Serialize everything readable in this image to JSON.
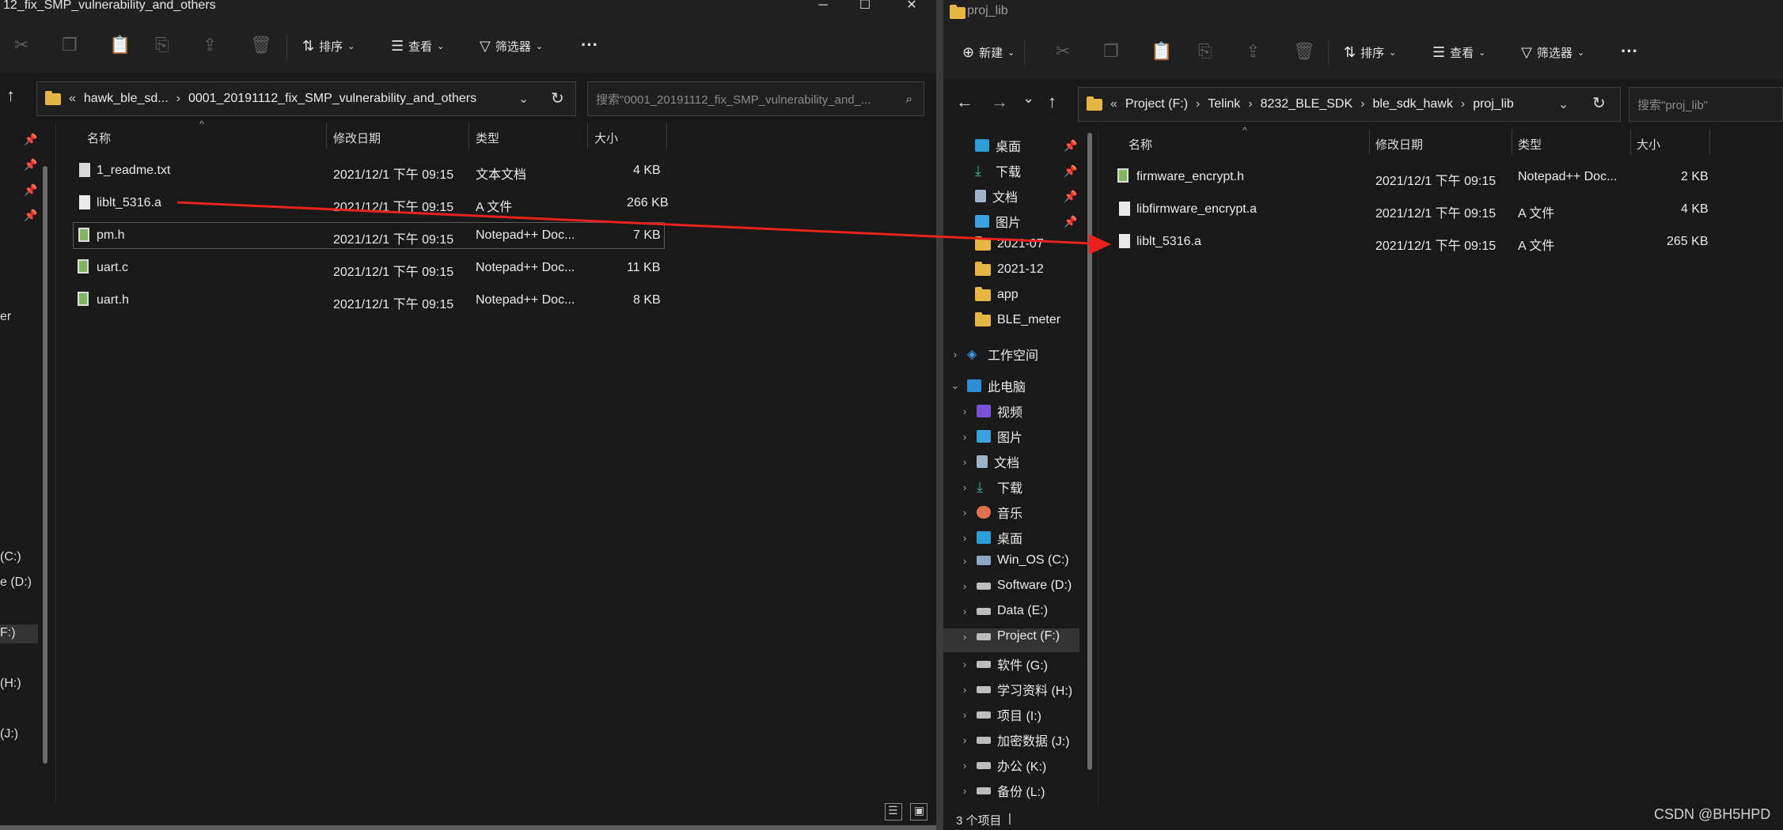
{
  "left_window": {
    "title": "12_fix_SMP_vulnerability_and_others",
    "toolbar": {
      "sort_label": "排序",
      "view_label": "查看",
      "filter_label": "筛选器",
      "more_label": "···"
    },
    "address": {
      "overflow": "«",
      "crumbs": [
        "hawk_ble_sd...",
        "0001_20191112_fix_SMP_vulnerability_and_others"
      ],
      "search_placeholder": "搜索\"0001_20191112_fix_SMP_vulnerability_and_..."
    },
    "columns": {
      "name": "名称",
      "date": "修改日期",
      "type": "类型",
      "size": "大小"
    },
    "files": [
      {
        "name": "1_readme.txt",
        "date": "2021/12/1 下午 09:15",
        "type": "文本文档",
        "size": "4 KB",
        "icon": "text-file-icon"
      },
      {
        "name": "liblt_5316.a",
        "date": "2021/12/1 下午 09:15",
        "type": "A 文件",
        "size": "266 KB",
        "icon": "file-icon"
      },
      {
        "name": "pm.h",
        "date": "2021/12/1 下午 09:15",
        "type": "Notepad++ Doc...",
        "size": "7 KB",
        "icon": "notepadpp-file-icon"
      },
      {
        "name": "uart.c",
        "date": "2021/12/1 下午 09:15",
        "type": "Notepad++ Doc...",
        "size": "11 KB",
        "icon": "notepadpp-file-icon"
      },
      {
        "name": "uart.h",
        "date": "2021/12/1 下午 09:15",
        "type": "Notepad++ Doc...",
        "size": "8 KB",
        "icon": "notepadpp-file-icon"
      }
    ],
    "left_edge_labels": [
      "er",
      "(C:)",
      "e (D:)",
      "F:)",
      "(H:)",
      "(J:)"
    ]
  },
  "right_window": {
    "title": "proj_lib",
    "toolbar": {
      "new_label": "新建",
      "sort_label": "排序",
      "view_label": "查看",
      "filter_label": "筛选器",
      "more_label": "···"
    },
    "address": {
      "overflow": "«",
      "crumbs": [
        "Project (F:)",
        "Telink",
        "8232_BLE_SDK",
        "ble_sdk_hawk",
        "proj_lib"
      ],
      "search_placeholder": "搜索\"proj_lib\""
    },
    "nav": {
      "quick_access": [
        "桌面",
        "下载",
        "文档",
        "图片",
        "2021-07",
        "2021-12",
        "app",
        "BLE_meter"
      ],
      "workspace": "工作空间",
      "this_pc": "此电脑",
      "pc_items": [
        "视频",
        "图片",
        "文档",
        "下载",
        "音乐",
        "桌面",
        "Win_OS (C:)",
        "Software (D:)",
        "Data (E:)",
        "Project (F:)",
        "软件 (G:)",
        "学习资料 (H:)",
        "项目 (I:)",
        "加密数据 (J:)",
        "办公 (K:)",
        "备份 (L:)"
      ]
    },
    "columns": {
      "name": "名称",
      "date": "修改日期",
      "type": "类型",
      "size": "大小"
    },
    "files": [
      {
        "name": "firmware_encrypt.h",
        "date": "2021/12/1 下午 09:15",
        "type": "Notepad++ Doc...",
        "size": "2 KB",
        "icon": "notepadpp-file-icon"
      },
      {
        "name": "libfirmware_encrypt.a",
        "date": "2021/12/1 下午 09:15",
        "type": "A 文件",
        "size": "4 KB",
        "icon": "file-icon"
      },
      {
        "name": "liblt_5316.a",
        "date": "2021/12/1 下午 09:15",
        "type": "A 文件",
        "size": "265 KB",
        "icon": "file-icon"
      }
    ],
    "status": "3 个项目",
    "status_sep": "|"
  },
  "annotation": {
    "color": "#e8221c"
  },
  "watermark": "CSDN @BH5HPD"
}
